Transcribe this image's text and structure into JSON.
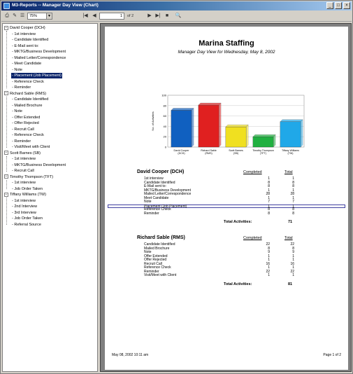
{
  "window": {
    "title": "M3-Reports -- Manager Day View (Chart)",
    "minimize": "_",
    "restore": "□",
    "close": "×"
  },
  "toolbar": {
    "zoom": "75%",
    "page_number": "1",
    "page_of": "of 2"
  },
  "tree": [
    {
      "name": "David Cooper (DCH)",
      "children": [
        "1st interview",
        "Candidate Identified",
        "E-Mail sent to:",
        "MKTG/Business Development",
        "Mailed Letter/Correspondence",
        "Meet Candidate",
        "Note",
        "Placement (Job Placement)",
        "Reference Check",
        "Reminder"
      ],
      "selected_index": 7
    },
    {
      "name": "Richard Sable (RMS)",
      "children": [
        "Candidate Identified",
        "Mailed Brochure",
        "Note",
        "Offer Extended",
        "Offer Rejected",
        "Recruit Call",
        "Reference Check",
        "Reminder",
        "Visit/Meet with Client"
      ],
      "selected_index": -1
    },
    {
      "name": "Scott Barnes (SB)",
      "children": [
        "1st interview",
        "MKTG/Business Development",
        "Recruit Call"
      ],
      "selected_index": -1
    },
    {
      "name": "Timothy Thompson (TFT)",
      "children": [
        "1st interview",
        "Job Order Taken"
      ],
      "selected_index": -1
    },
    {
      "name": "Tiffany Williams (TW)",
      "children": [
        "1st interview",
        "2nd Interview",
        "3rd Interview",
        "Job Order Taken",
        "Referral Source"
      ],
      "selected_index": -1
    }
  ],
  "report": {
    "company": "Marina Staffing",
    "subtitle": "Manager Day View for Wednesday, May 8, 2002",
    "completed_label": "Completed",
    "total_label": "Total",
    "total_activities_label": "Total Activities:",
    "footer_date": "May 08, 2002 10:11 am",
    "footer_page": "Page 1 of 2",
    "sections": [
      {
        "name": "David Cooper (DCH)",
        "rows": [
          {
            "label": "1st interview",
            "completed": "1",
            "total": "1"
          },
          {
            "label": "Candidate Identified",
            "completed": "8",
            "total": "8"
          },
          {
            "label": "E-Mail sent to:",
            "completed": "8",
            "total": "8"
          },
          {
            "label": "MKTG/Business Development",
            "completed": "1",
            "total": "1"
          },
          {
            "label": "Mailed Letter/Correspondence",
            "completed": "28",
            "total": "28"
          },
          {
            "label": "Meet Candidate",
            "completed": "1",
            "total": "1"
          },
          {
            "label": "Note",
            "completed": "7",
            "total": "7"
          },
          {
            "label": "Placement (Job Placement)",
            "completed": "1",
            "total": "1"
          },
          {
            "label": "Reference Check",
            "completed": "8",
            "total": "8"
          },
          {
            "label": "Reminder",
            "completed": "8",
            "total": "8"
          }
        ],
        "total_activities": "71",
        "highlight_index": 7
      },
      {
        "name": "Richard Sable (RMS)",
        "rows": [
          {
            "label": "Candidate Identified",
            "completed": "22",
            "total": "22"
          },
          {
            "label": "Mailed Brochure",
            "completed": "8",
            "total": "8"
          },
          {
            "label": "Note",
            "completed": "9",
            "total": "9"
          },
          {
            "label": "Offer Extended",
            "completed": "1",
            "total": "1"
          },
          {
            "label": "Offer Rejected",
            "completed": "1",
            "total": "1"
          },
          {
            "label": "Recruit Call",
            "completed": "16",
            "total": "16"
          },
          {
            "label": "Reference Check",
            "completed": "1",
            "total": "1"
          },
          {
            "label": "Reminder",
            "completed": "22",
            "total": "22"
          },
          {
            "label": "Visit/Meet with Client",
            "completed": "1",
            "total": "1"
          }
        ],
        "total_activities": "81",
        "highlight_index": -1
      }
    ]
  },
  "chart_data": {
    "type": "bar",
    "categories": [
      "David Cooper (DCH)",
      "Richard Sable (RMS)",
      "Scott Barnes (SB)",
      "Timothy Thompson (TFT)",
      "Tiffany Williams (TW)"
    ],
    "values": [
      71,
      81,
      39,
      20,
      49
    ],
    "colors": [
      "#1060c0",
      "#e02020",
      "#f0e020",
      "#20b040",
      "#20a8e8"
    ],
    "ylabel": "No. of Activities",
    "ylim": [
      0,
      100
    ],
    "yticks": [
      0,
      20,
      40,
      60,
      80,
      100
    ]
  }
}
